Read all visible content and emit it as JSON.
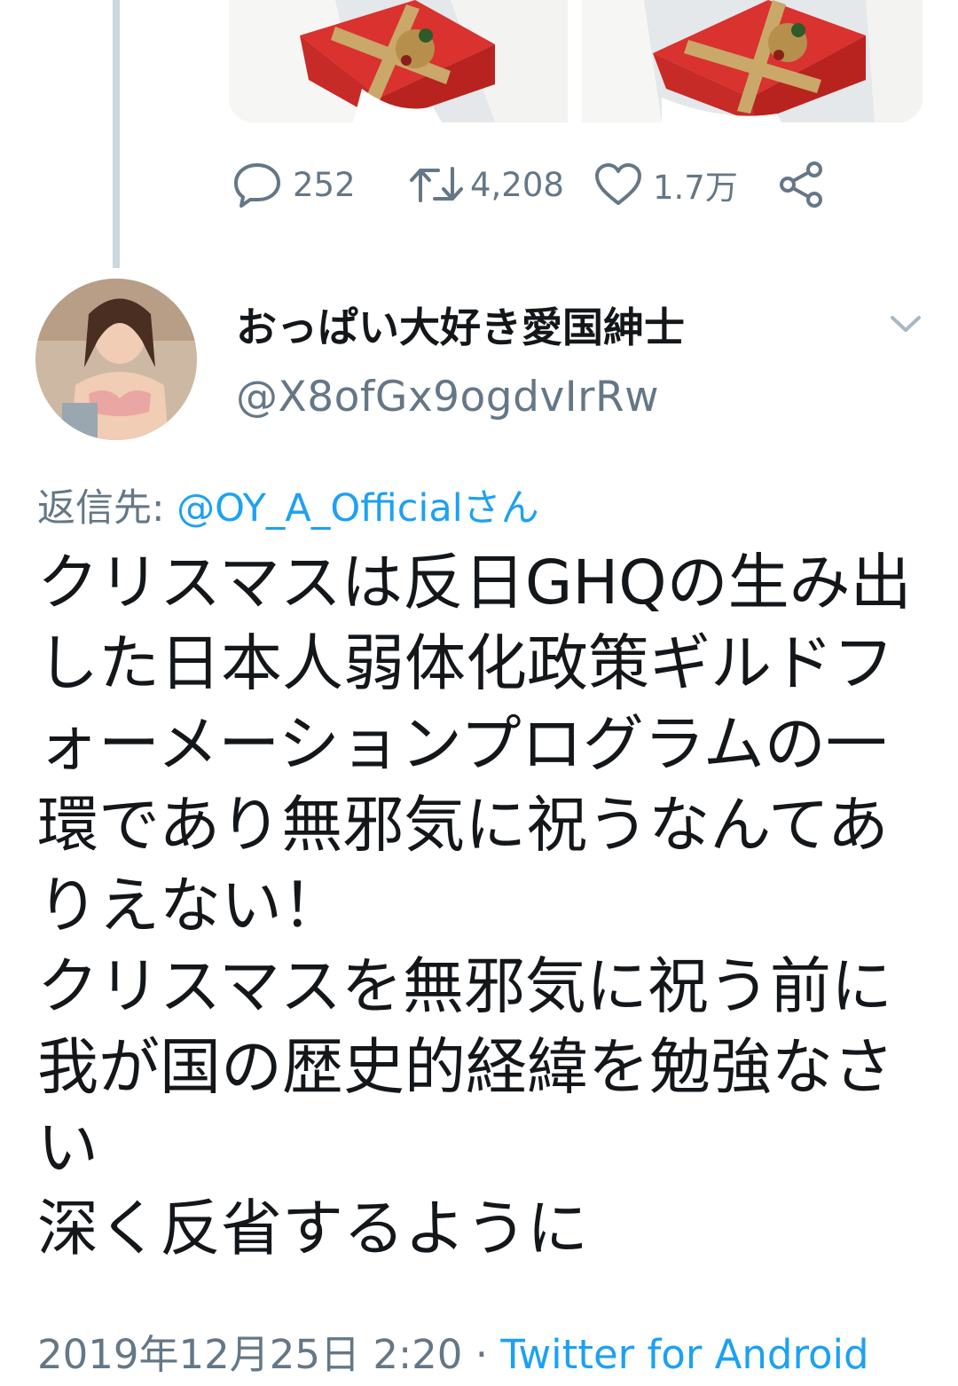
{
  "previous_tweet": {
    "stats": {
      "replies": "252",
      "retweets": "4,208",
      "likes": "1.7万"
    },
    "icons": {
      "reply": "reply-icon",
      "retweet": "retweet-icon",
      "like": "heart-icon",
      "share": "share-icon"
    }
  },
  "tweet": {
    "author": {
      "display_name": "おっぱい大好き愛国紳士",
      "handle": "@X8ofGx9ogdvIrRw"
    },
    "reply_to": {
      "prefix": "返信先: ",
      "mention": "@OY_A_Officialさん"
    },
    "text": "クリスマスは反日GHQの生み出した日本人弱体化政策ギルドフォーメーションプログラムの一環であり無邪気に祝うなんてありえない！\nクリスマスを無邪気に祝う前に我が国の歴史的経緯を勉強なさい\n深く反省するように",
    "timestamp": "2019年12月25日 2:20",
    "separator": " · ",
    "source": "Twitter for Android"
  },
  "colors": {
    "accent": "#1da1f2",
    "secondary_text": "#657786",
    "primary_text": "#14171a",
    "thread_line": "#ccd6dd"
  }
}
